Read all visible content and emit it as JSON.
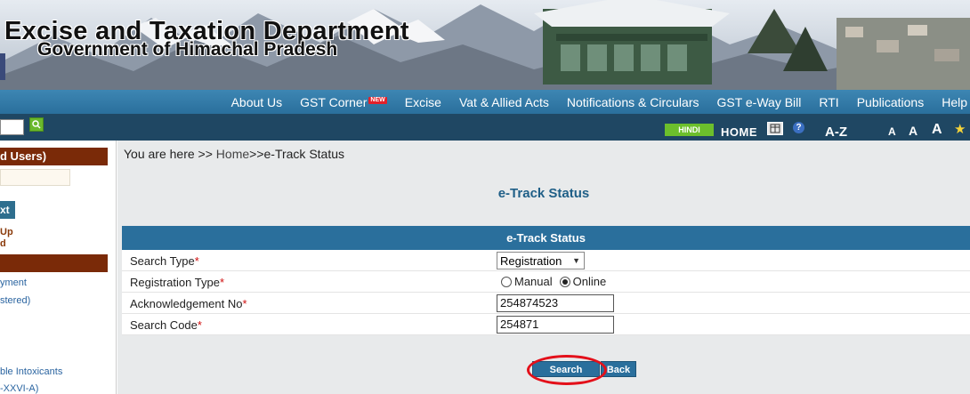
{
  "header": {
    "title": "Excise and Taxation Department",
    "subtitle": "Government of Himachal Pradesh"
  },
  "nav": {
    "items": [
      {
        "label": "About Us"
      },
      {
        "label": "GST Corner",
        "badge": "NEW"
      },
      {
        "label": "Excise"
      },
      {
        "label": "Vat & Allied Acts"
      },
      {
        "label": "Notifications & Circulars"
      },
      {
        "label": "GST e-Way Bill"
      },
      {
        "label": "RTI"
      },
      {
        "label": "Publications"
      },
      {
        "label": "Help"
      }
    ]
  },
  "toolbar": {
    "hindi": "HINDI",
    "home": "HOME",
    "az": "A-Z",
    "font_small": "A",
    "font_medium": "A",
    "font_large": "A",
    "help": "?"
  },
  "sidebar": {
    "heading": "d Users)",
    "button": "xt",
    "up": "Up",
    "d": "d",
    "links": [
      "yment",
      "stered)",
      "ble Intoxicants",
      "-XXVI-A)"
    ]
  },
  "main": {
    "breadcrumb": {
      "prefix": "You are here >> ",
      "home": "Home",
      "current": ">>e-Track Status"
    },
    "page_title": "e-Track Status",
    "form": {
      "header": "e-Track Status",
      "required_mark": "*",
      "search_type": {
        "label": "Search Type",
        "value": "Registration"
      },
      "registration_type": {
        "label": "Registration Type",
        "options": [
          "Manual",
          "Online"
        ],
        "selected": "Online"
      },
      "ack_no": {
        "label": "Acknowledgement No",
        "value": "254874523"
      },
      "search_code": {
        "label": "Search Code",
        "value": "254871"
      }
    },
    "buttons": {
      "search": "Search",
      "back": "Back"
    }
  },
  "colors": {
    "nav_bg": "#2a6f9c",
    "utility_bg": "#1f4763",
    "sidebar_heading": "#7a2a08",
    "title_blue": "#1f5f87",
    "highlight": "#e3101a"
  }
}
